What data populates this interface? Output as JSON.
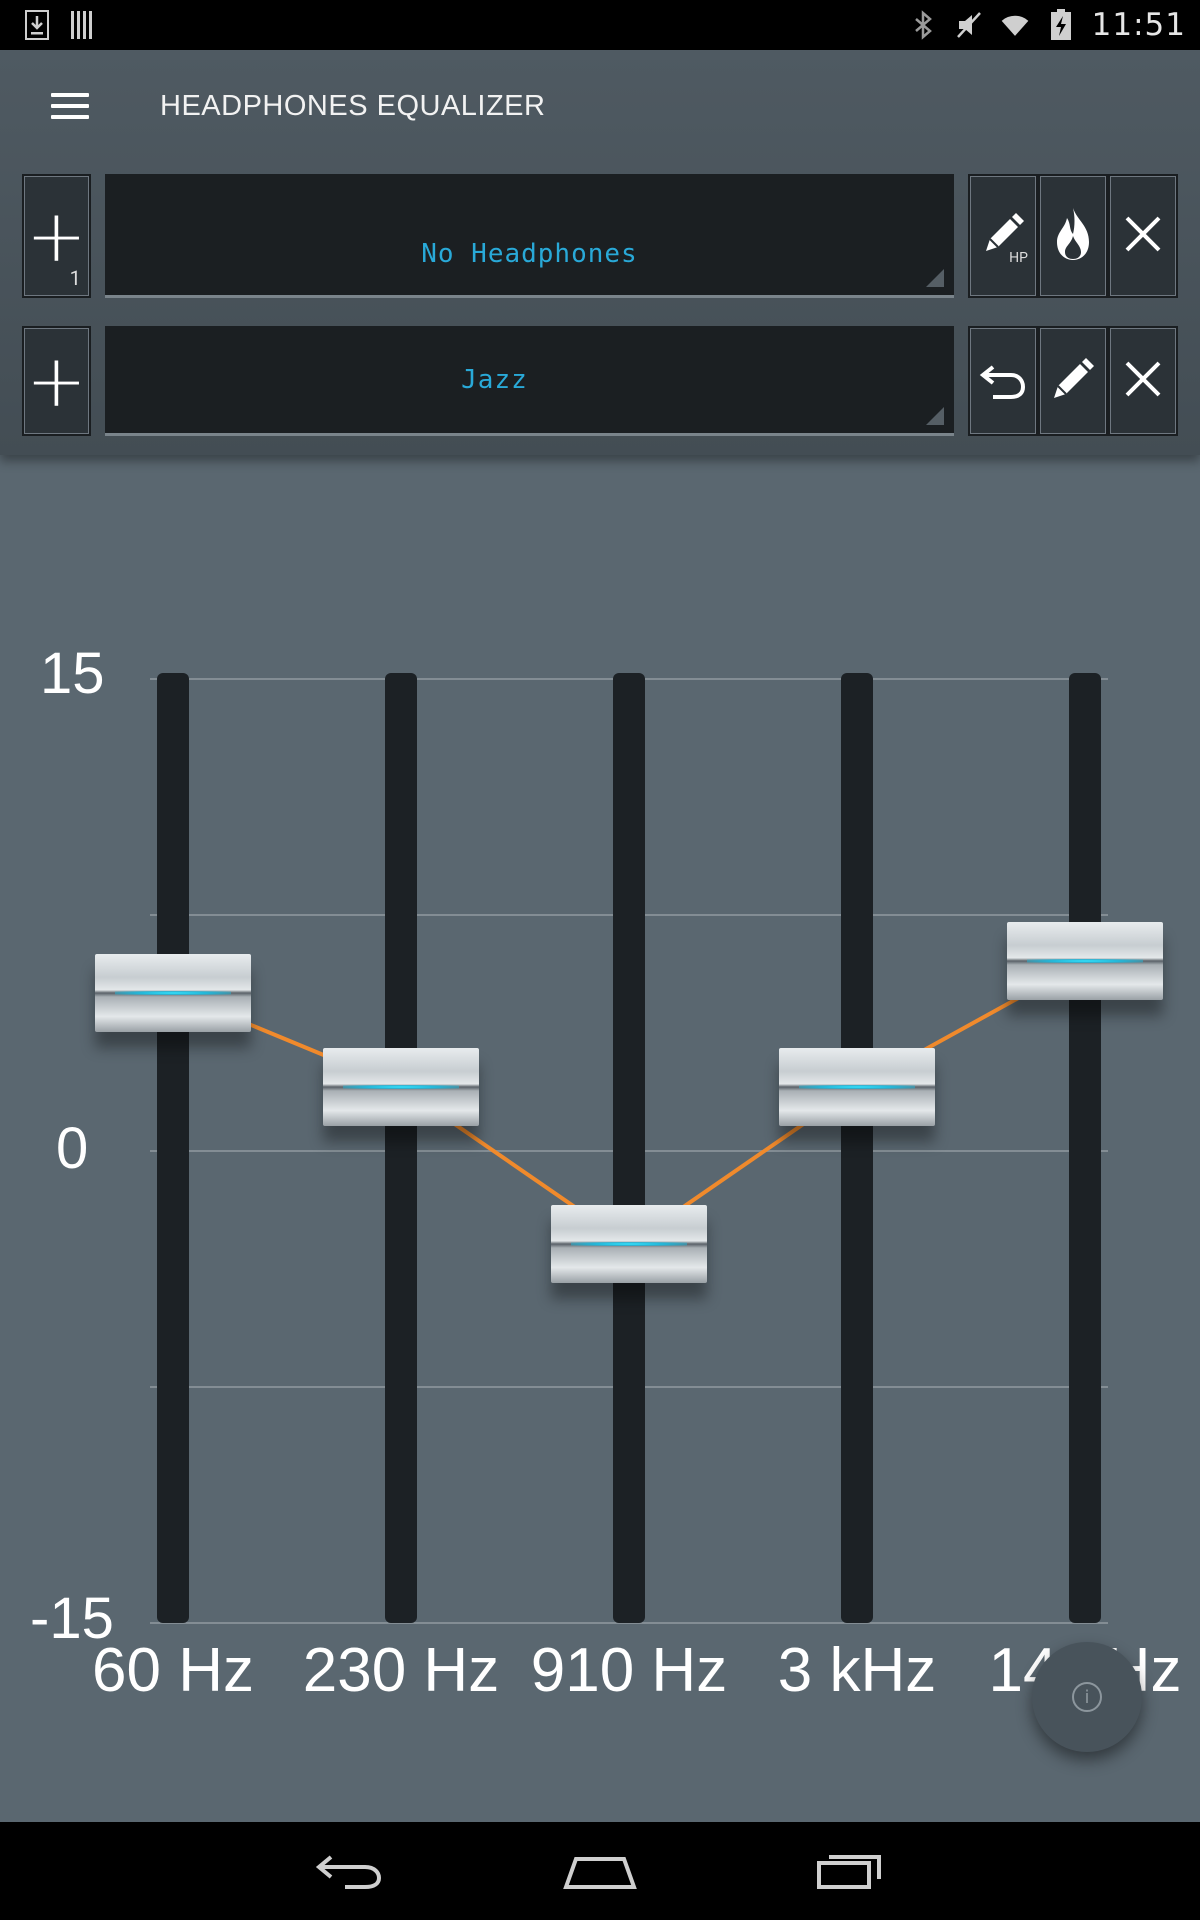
{
  "status_bar": {
    "time": "11:51",
    "left_icons": [
      "download-icon",
      "barcode-icon"
    ],
    "right_icons": [
      "bluetooth-icon",
      "mute-icon",
      "wifi-icon",
      "battery-charging-icon"
    ]
  },
  "header": {
    "title": "HEADPHONES EQUALIZER"
  },
  "headphones_row": {
    "add_count": "1",
    "display_text": "No Headphones",
    "sub_label": "HP"
  },
  "preset_row": {
    "display_text": "Jazz"
  },
  "eq": {
    "scale": {
      "top": "15",
      "mid": "0",
      "bottom": "-15"
    },
    "bands": [
      {
        "label": "60 Hz",
        "gain_db": 5
      },
      {
        "label": "230 Hz",
        "gain_db": 2
      },
      {
        "label": "910 Hz",
        "gain_db": -3
      },
      {
        "label": "3 kHz",
        "gain_db": 2
      },
      {
        "label": "14 kHz",
        "gain_db": 6
      }
    ],
    "curve_color": "#f08a2c",
    "glow_color": "#3be7ff"
  },
  "colors": {
    "accent_text": "#29a9d8",
    "background": "#5a6770"
  }
}
